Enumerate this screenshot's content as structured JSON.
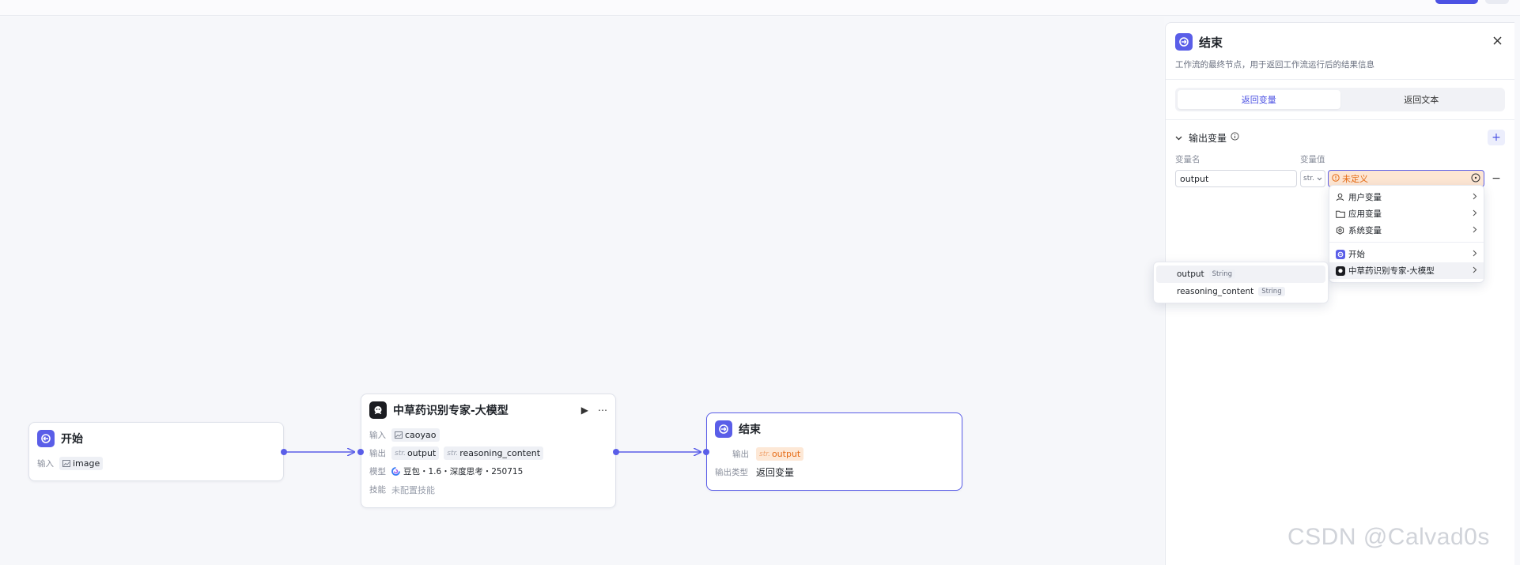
{
  "nodes": {
    "start": {
      "title": "开始",
      "input_label": "输入",
      "input_var": "image"
    },
    "llm": {
      "title": "中草药识别专家-大模型",
      "input_label": "输入",
      "input_var": "caoyao",
      "output_label": "输出",
      "output_prefix": "str.",
      "outputs": [
        "output",
        "reasoning_content"
      ],
      "model_label": "模型",
      "model_value": "豆包・1.6・深度思考・250715",
      "skill_label": "技能",
      "skill_value": "未配置技能"
    },
    "end": {
      "title": "结束",
      "output_label": "输出",
      "output_prefix": "str.",
      "output_var": "output",
      "output_type_label": "输出类型",
      "output_type_value": "返回变量"
    }
  },
  "panel": {
    "title": "结束",
    "description": "工作流的最终节点，用于返回工作流运行后的结果信息",
    "tabs": [
      {
        "label": "返回变量",
        "active": true
      },
      {
        "label": "返回文本",
        "active": false
      }
    ],
    "section_title": "输出变量",
    "col_name": "变量名",
    "col_value": "变量值",
    "var_name_value": "output",
    "var_type": "str.",
    "var_value_text": "未定义"
  },
  "dropdown": {
    "items": [
      {
        "icon": "user-icon",
        "label": "用户变量"
      },
      {
        "icon": "folder-icon",
        "label": "应用变量"
      },
      {
        "icon": "gear-icon",
        "label": "系统变量"
      }
    ],
    "node_items": [
      {
        "icon": "start-node-icon",
        "label": "开始"
      },
      {
        "icon": "llm-node-icon",
        "label": "中草药识别专家-大模型"
      }
    ]
  },
  "submenu": {
    "items": [
      {
        "label": "output",
        "type": "String"
      },
      {
        "label": "reasoning_content",
        "type": "String"
      }
    ]
  },
  "watermark": "CSDN @Calvad0s",
  "colors": {
    "accent": "#5a5ee8",
    "warning": "#e56b15",
    "warning_bg": "#fde6d3"
  }
}
